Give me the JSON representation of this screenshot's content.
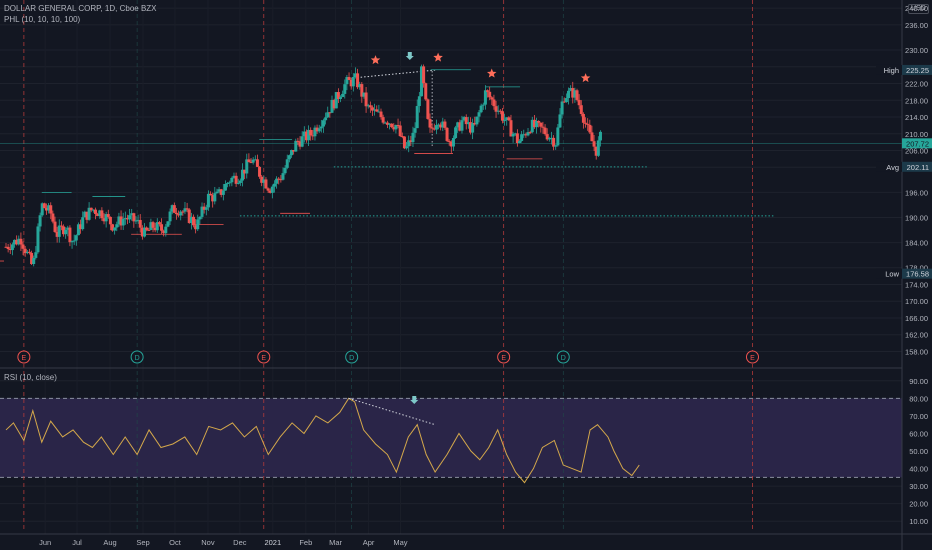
{
  "header": {
    "symbol": "DOLLAR GENERAL CORP, 1D, Cboe BZX",
    "indicator": "PHL (10, 10, 10, 100)"
  },
  "price_axis": {
    "currency": "USD",
    "ticks": [
      "240.00",
      "236.00",
      "230.00",
      "226.00",
      "222.00",
      "218.00",
      "214.00",
      "210.00",
      "206.00",
      "202.00",
      "196.00",
      "190.00",
      "184.00",
      "178.00",
      "174.00",
      "170.00",
      "166.00",
      "162.00",
      "158.00"
    ],
    "min": 155,
    "max": 241
  },
  "badges": {
    "high": {
      "label": "High",
      "value": "225.25",
      "price": 225.25
    },
    "current": {
      "value": "207.72",
      "price": 207.72
    },
    "avg": {
      "label": "Avg",
      "value": "202.11",
      "price": 202.11
    },
    "low": {
      "label": "Low",
      "value": "176.58",
      "price": 176.58
    }
  },
  "time_axis": {
    "labels": [
      "Jun",
      "Jul",
      "Aug",
      "Sep",
      "Oct",
      "Nov",
      "Dec",
      "2021",
      "Feb",
      "Mar",
      "Apr",
      "May"
    ]
  },
  "events": [
    {
      "type": "E",
      "day": 12
    },
    {
      "type": "D",
      "day": 88
    },
    {
      "type": "E",
      "day": 173
    },
    {
      "type": "D",
      "day": 232
    },
    {
      "type": "E",
      "day": 334
    },
    {
      "type": "D",
      "day": 374
    },
    {
      "type": "E",
      "day": 501
    }
  ],
  "rsi": {
    "label": "RSI (10, close)",
    "ticks": [
      "90.00",
      "80.00",
      "70.00",
      "60.00",
      "50.00",
      "40.00",
      "30.00",
      "20.00",
      "10.00"
    ],
    "upper": 80,
    "lower": 35
  },
  "colors": {
    "up": "#26a69a",
    "down": "#ef5350",
    "rsi_line": "#d4a84b",
    "rsi_band": "#2a2548",
    "marker": "#ff6e5a",
    "arrow": "#7ec8c8"
  },
  "icons": {
    "star": "star-marker-icon",
    "arrow": "down-arrow-icon"
  },
  "chart_data": {
    "type": "candlestick",
    "title": "DOLLAR GENERAL CORP, 1D, Cboe BZX",
    "x_start": "2020-05-12",
    "anchors": [
      [
        0,
        183
      ],
      [
        10,
        185
      ],
      [
        18,
        178
      ],
      [
        24,
        193
      ],
      [
        30,
        191
      ],
      [
        34,
        186
      ],
      [
        40,
        188
      ],
      [
        45,
        184
      ],
      [
        52,
        190
      ],
      [
        58,
        192
      ],
      [
        65,
        191
      ],
      [
        72,
        188
      ],
      [
        80,
        190
      ],
      [
        88,
        189
      ],
      [
        93,
        186
      ],
      [
        99,
        188
      ],
      [
        105,
        187
      ],
      [
        112,
        192
      ],
      [
        117,
        192
      ],
      [
        123,
        190
      ],
      [
        128,
        188
      ],
      [
        136,
        195
      ],
      [
        142,
        195
      ],
      [
        150,
        199
      ],
      [
        157,
        200
      ],
      [
        165,
        204
      ],
      [
        171,
        200
      ],
      [
        177,
        197
      ],
      [
        185,
        200
      ],
      [
        195,
        208
      ],
      [
        205,
        210
      ],
      [
        213,
        214
      ],
      [
        221,
        218
      ],
      [
        228,
        222
      ],
      [
        235,
        223
      ],
      [
        243,
        216
      ],
      [
        252,
        214
      ],
      [
        262,
        212
      ],
      [
        268,
        206
      ],
      [
        274,
        210
      ],
      [
        279,
        225
      ],
      [
        284,
        210
      ],
      [
        290,
        214
      ],
      [
        298,
        208
      ],
      [
        306,
        213
      ],
      [
        314,
        211
      ],
      [
        322,
        220
      ],
      [
        330,
        216
      ],
      [
        337,
        212
      ],
      [
        344,
        208
      ],
      [
        352,
        212
      ],
      [
        360,
        211
      ],
      [
        369,
        208
      ],
      [
        374,
        219
      ],
      [
        381,
        220
      ],
      [
        386,
        216
      ],
      [
        391,
        210
      ],
      [
        396,
        206
      ],
      [
        399,
        209
      ]
    ],
    "rsi_anchors": [
      [
        0,
        62
      ],
      [
        5,
        66
      ],
      [
        12,
        56
      ],
      [
        18,
        73
      ],
      [
        24,
        55
      ],
      [
        30,
        67
      ],
      [
        38,
        58
      ],
      [
        45,
        62
      ],
      [
        52,
        55
      ],
      [
        58,
        52
      ],
      [
        64,
        58
      ],
      [
        72,
        48
      ],
      [
        80,
        58
      ],
      [
        88,
        48
      ],
      [
        96,
        62
      ],
      [
        104,
        52
      ],
      [
        112,
        54
      ],
      [
        120,
        58
      ],
      [
        128,
        48
      ],
      [
        136,
        64
      ],
      [
        144,
        62
      ],
      [
        152,
        66
      ],
      [
        160,
        58
      ],
      [
        168,
        64
      ],
      [
        176,
        48
      ],
      [
        184,
        58
      ],
      [
        192,
        66
      ],
      [
        200,
        60
      ],
      [
        208,
        70
      ],
      [
        216,
        66
      ],
      [
        224,
        72
      ],
      [
        230,
        80
      ],
      [
        234,
        78
      ],
      [
        240,
        62
      ],
      [
        248,
        54
      ],
      [
        256,
        48
      ],
      [
        262,
        38
      ],
      [
        270,
        58
      ],
      [
        276,
        65
      ],
      [
        282,
        48
      ],
      [
        288,
        38
      ],
      [
        296,
        48
      ],
      [
        304,
        60
      ],
      [
        312,
        50
      ],
      [
        318,
        45
      ],
      [
        324,
        52
      ],
      [
        330,
        62
      ],
      [
        336,
        48
      ],
      [
        342,
        38
      ],
      [
        348,
        32
      ],
      [
        354,
        40
      ],
      [
        360,
        52
      ],
      [
        368,
        56
      ],
      [
        374,
        42
      ],
      [
        380,
        40
      ],
      [
        386,
        38
      ],
      [
        392,
        62
      ],
      [
        397,
        65
      ],
      [
        404,
        58
      ],
      [
        408,
        50
      ],
      [
        414,
        40
      ],
      [
        420,
        36
      ],
      [
        425,
        42
      ]
    ],
    "rsi_ylim": [
      5,
      95
    ]
  }
}
